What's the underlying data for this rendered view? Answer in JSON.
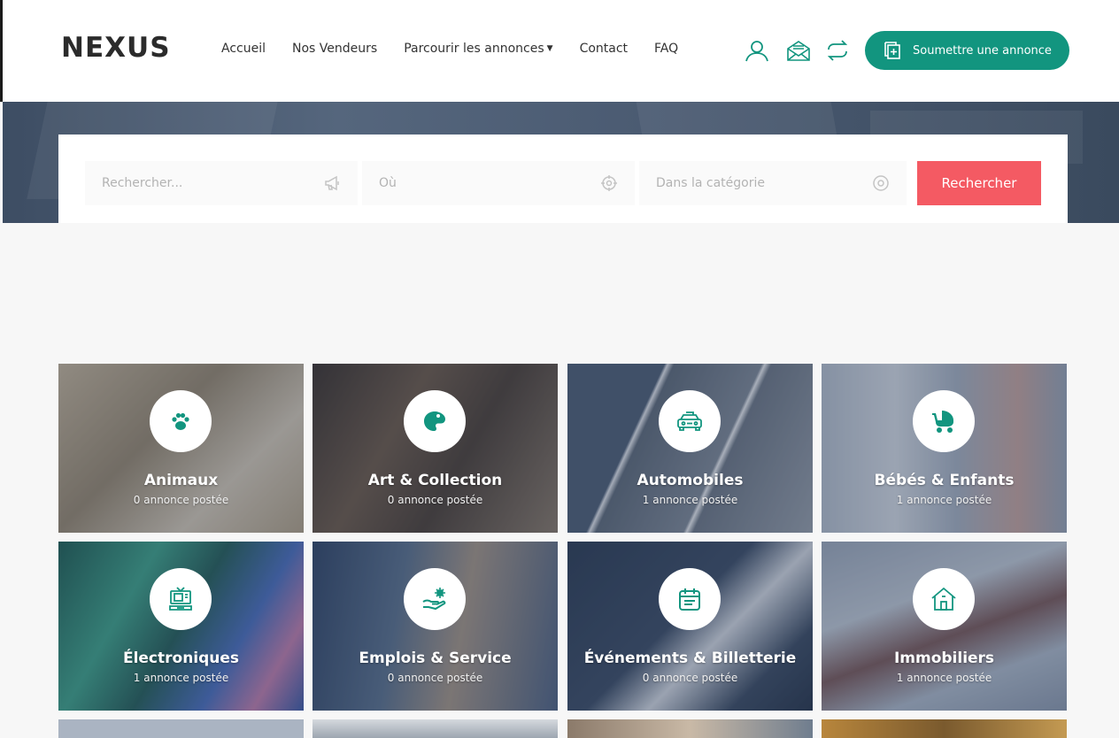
{
  "header": {
    "logo": "NEXUS",
    "nav": [
      {
        "label": "Accueil"
      },
      {
        "label": "Nos Vendeurs"
      },
      {
        "label": "Parcourir les annonces",
        "caret": "⌄"
      },
      {
        "label": "Contact"
      },
      {
        "label": "FAQ"
      }
    ],
    "icons": [
      "user-icon",
      "mail-icon",
      "exchange-icon"
    ],
    "submit_label": "Soumettre une annonce"
  },
  "search": {
    "keyword_placeholder": "Rechercher...",
    "location_placeholder": "Où",
    "category_placeholder": "Dans la catégorie",
    "button_label": "Rechercher"
  },
  "categories": [
    {
      "title": "Animaux",
      "count": "0 annonce postée",
      "icon": "paw-icon",
      "color": "#b9a68a"
    },
    {
      "title": "Art & Collection",
      "count": "0 annonce postée",
      "icon": "palette-icon",
      "color": "#4a3f38"
    },
    {
      "title": "Automobiles",
      "count": "1 annonce postée",
      "icon": "car-icon",
      "color": "#5f6c7e"
    },
    {
      "title": "Bébés & Enfants",
      "count": "1 annonce postée",
      "icon": "stroller-icon",
      "color": "#a3aec0"
    },
    {
      "title": "Électroniques",
      "count": "1 annonce postée",
      "icon": "tv-icon",
      "color": "#2c7a6e"
    },
    {
      "title": "Emplois & Service",
      "count": "0 annonce postée",
      "icon": "hand-gear-icon",
      "color": "#5b6e86"
    },
    {
      "title": "Événements & Billetterie",
      "count": "0 annonce postée",
      "icon": "calendar-icon",
      "color": "#2e3d55"
    },
    {
      "title": "Immobiliers",
      "count": "1 annonce postée",
      "icon": "house-icon",
      "color": "#8795a8"
    }
  ],
  "colors": {
    "accent": "#12957f",
    "search_button": "#f45a63"
  }
}
